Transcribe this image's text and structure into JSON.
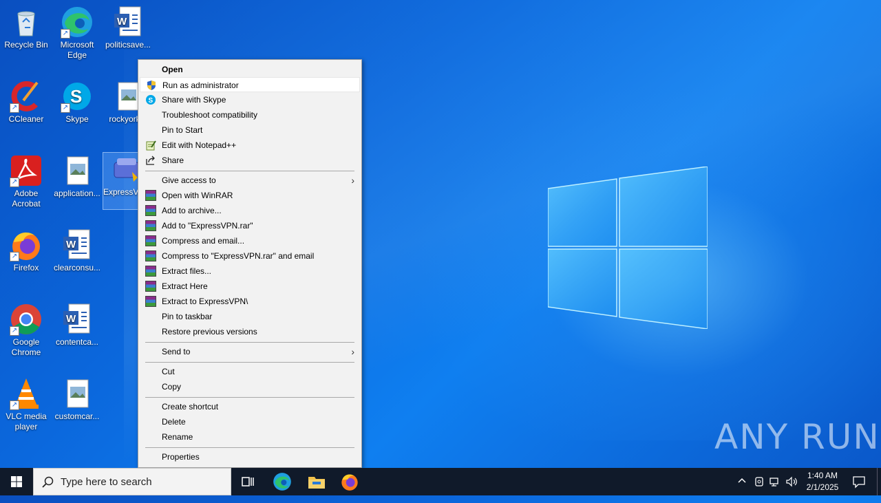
{
  "desktop_icons": [
    {
      "label": "Recycle Bin"
    },
    {
      "label": "Microsoft Edge"
    },
    {
      "label": "politicsave..."
    },
    {
      "label": "CCleaner"
    },
    {
      "label": "Skype"
    },
    {
      "label": "rockyork..."
    },
    {
      "label": "Adobe Acrobat"
    },
    {
      "label": "application..."
    },
    {
      "label": "ExpressV...xe"
    },
    {
      "label": "Firefox"
    },
    {
      "label": "clearconsu..."
    },
    {
      "label": "Google Chrome"
    },
    {
      "label": "contentca..."
    },
    {
      "label": "VLC media player"
    },
    {
      "label": "customcar..."
    }
  ],
  "context_menu": {
    "items": [
      {
        "label": "Open"
      },
      {
        "label": "Run as administrator"
      },
      {
        "label": "Share with Skype"
      },
      {
        "label": "Troubleshoot compatibility"
      },
      {
        "label": "Pin to Start"
      },
      {
        "label": "Edit with Notepad++"
      },
      {
        "label": "Share"
      },
      {
        "label": "Give access to"
      },
      {
        "label": "Open with WinRAR"
      },
      {
        "label": "Add to archive..."
      },
      {
        "label": "Add to \"ExpressVPN.rar\""
      },
      {
        "label": "Compress and email..."
      },
      {
        "label": "Compress to \"ExpressVPN.rar\" and email"
      },
      {
        "label": "Extract files..."
      },
      {
        "label": "Extract Here"
      },
      {
        "label": "Extract to ExpressVPN\\"
      },
      {
        "label": "Pin to taskbar"
      },
      {
        "label": "Restore previous versions"
      },
      {
        "label": "Send to"
      },
      {
        "label": "Cut"
      },
      {
        "label": "Copy"
      },
      {
        "label": "Create shortcut"
      },
      {
        "label": "Delete"
      },
      {
        "label": "Rename"
      },
      {
        "label": "Properties"
      }
    ]
  },
  "taskbar": {
    "search_placeholder": "Type here to search",
    "clock_time": "1:40 AM",
    "clock_date": "2/1/2025"
  },
  "watermark": "ANY RUN",
  "colors": {
    "wallpaper": "#0b68dd",
    "menu_bg": "#f2f2f2",
    "taskbar_bg": "#101a2a"
  }
}
